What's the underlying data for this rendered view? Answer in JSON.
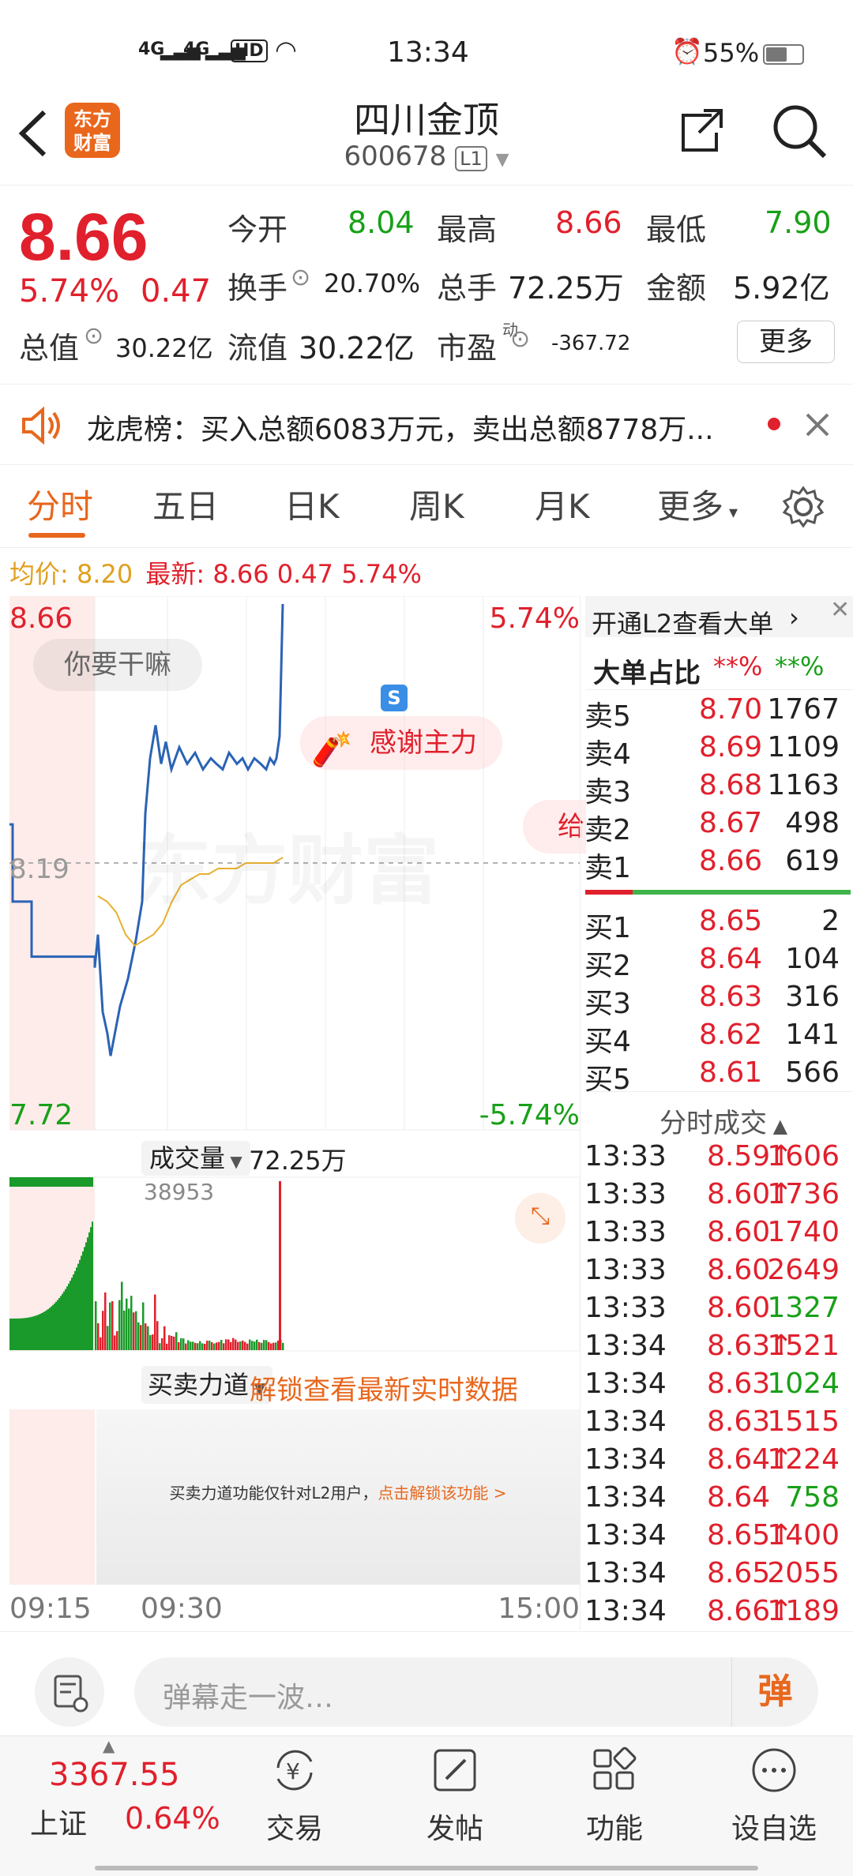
{
  "status": {
    "time": "13:34",
    "battery": "55%",
    "net1": "4G",
    "net2": "4G",
    "hd": "HD"
  },
  "header": {
    "title": "四川金顶",
    "code": "600678",
    "level": "L1",
    "logo_line1": "东方",
    "logo_line2": "财富"
  },
  "quote": {
    "price": "8.66",
    "change_pct": "5.74%",
    "change": "0.47",
    "open_label": "今开",
    "open": "8.04",
    "high_label": "最高",
    "high": "8.66",
    "low_label": "最低",
    "low": "7.90",
    "turnover_label": "换手",
    "turnover": "20.70%",
    "volume_label": "总手",
    "volume": "72.25万",
    "amount_label": "金额",
    "amount": "5.92亿",
    "mktcap_label": "总值",
    "mktcap": "30.22亿",
    "float_label": "流值",
    "float_cap": "30.22亿",
    "pe_label": "市盈",
    "pe_sup": "动",
    "pe": "-367.72",
    "more_button": "更多"
  },
  "notice": {
    "text": "龙虎榜：买入总额6083万元，卖出总额8778万..."
  },
  "tabs": [
    "分时",
    "五日",
    "日K",
    "周K",
    "月K",
    "更多"
  ],
  "active_tab": "分时",
  "chart_info": {
    "avg_label": "均价:",
    "avg": "8.20",
    "latest_label": "最新:",
    "latest": "8.66",
    "chg": "0.47",
    "pct": "5.74%"
  },
  "chart_data": {
    "type": "line",
    "title": "",
    "y_max_label": "8.66",
    "y_min_label": "7.72",
    "y_mid_label": "8.19",
    "pct_max_label": "5.74%",
    "pct_min_label": "-5.74%",
    "ylim": [
      7.72,
      8.66
    ],
    "x_labels": [
      "09:15",
      "09:30",
      "15:00"
    ],
    "series": [
      {
        "values": [
          8.26,
          8.26,
          8.12,
          8.12,
          8.02,
          8.02,
          8.02,
          8.02,
          8.0,
          8.06,
          7.92,
          7.88,
          7.84,
          7.93,
          7.98,
          8.05,
          8.12,
          8.28,
          8.38,
          8.44,
          8.37,
          8.41,
          8.36,
          8.4,
          8.37,
          8.39,
          8.36,
          8.38,
          8.37,
          8.36,
          8.39,
          8.37,
          8.38,
          8.36,
          8.38,
          8.37,
          8.36,
          8.38,
          8.37,
          8.38,
          8.4,
          8.42,
          8.66
        ]
      },
      {
        "values": [
          8.13,
          8.12,
          8.1,
          8.06,
          8.04,
          8.05,
          8.06,
          8.08,
          8.12,
          8.15,
          8.16,
          8.17,
          8.17,
          8.18,
          8.18,
          8.18,
          8.19,
          8.19,
          8.19,
          8.19,
          8.2
        ]
      }
    ],
    "volume_label": "成交量",
    "volume_total": "72.25万",
    "volume_max_label": "38953"
  },
  "comments": {
    "bubble1": "你要干嘛",
    "bubble2": "感谢主力",
    "bubble3": "给",
    "watermark": "东方财富",
    "marker": "S"
  },
  "orderbook": {
    "l2_link": "开通L2查看大单",
    "big_label": "大单占比",
    "big_red": "**%",
    "big_green": "**%",
    "sells": [
      {
        "label": "卖5",
        "price": "8.70",
        "vol": "1767"
      },
      {
        "label": "卖4",
        "price": "8.69",
        "vol": "1109"
      },
      {
        "label": "卖3",
        "price": "8.68",
        "vol": "1163"
      },
      {
        "label": "卖2",
        "price": "8.67",
        "vol": "498"
      },
      {
        "label": "卖1",
        "price": "8.66",
        "vol": "619"
      }
    ],
    "buys": [
      {
        "label": "买1",
        "price": "8.65",
        "vol": "2"
      },
      {
        "label": "买2",
        "price": "8.64",
        "vol": "104"
      },
      {
        "label": "买3",
        "price": "8.63",
        "vol": "316"
      },
      {
        "label": "买4",
        "price": "8.62",
        "vol": "141"
      },
      {
        "label": "买5",
        "price": "8.61",
        "vol": "566"
      }
    ]
  },
  "trades": {
    "header": "分时成交",
    "rows": [
      {
        "time": "13:33",
        "price": "8.59",
        "arrow": "↑",
        "vol": "1606",
        "color": "red"
      },
      {
        "time": "13:33",
        "price": "8.60",
        "arrow": "↑",
        "vol": "1736",
        "color": "red"
      },
      {
        "time": "13:33",
        "price": "8.60",
        "arrow": "",
        "vol": "1740",
        "color": "red"
      },
      {
        "time": "13:33",
        "price": "8.60",
        "arrow": "",
        "vol": "2649",
        "color": "red"
      },
      {
        "time": "13:33",
        "price": "8.60",
        "arrow": "",
        "vol": "1327",
        "color": "green"
      },
      {
        "time": "13:34",
        "price": "8.63",
        "arrow": "↑",
        "vol": "1521",
        "color": "red"
      },
      {
        "time": "13:34",
        "price": "8.63",
        "arrow": "",
        "vol": "1024",
        "color": "green"
      },
      {
        "time": "13:34",
        "price": "8.63",
        "arrow": "",
        "vol": "1515",
        "color": "red"
      },
      {
        "time": "13:34",
        "price": "8.64",
        "arrow": "↑",
        "vol": "1224",
        "color": "red"
      },
      {
        "time": "13:34",
        "price": "8.64",
        "arrow": "",
        "vol": "758",
        "color": "green"
      },
      {
        "time": "13:34",
        "price": "8.65",
        "arrow": "↑",
        "vol": "1400",
        "color": "red"
      },
      {
        "time": "13:34",
        "price": "8.65",
        "arrow": "",
        "vol": "2055",
        "color": "red"
      },
      {
        "time": "13:34",
        "price": "8.66",
        "arrow": "↑",
        "vol": "1189",
        "color": "red"
      }
    ]
  },
  "force": {
    "label": "买卖力道",
    "unlock": "解锁查看最新实时数据",
    "notice": "买卖力道功能仅针对L2用户，",
    "notice_link": "点击解锁该功能 >"
  },
  "danmu": {
    "placeholder": "弹幕走一波…",
    "button": "弹"
  },
  "bottom": {
    "index_value": "3367.55",
    "index_name": "上证",
    "index_pct": "0.64%",
    "nav": [
      "交易",
      "发帖",
      "功能",
      "设自选"
    ]
  }
}
